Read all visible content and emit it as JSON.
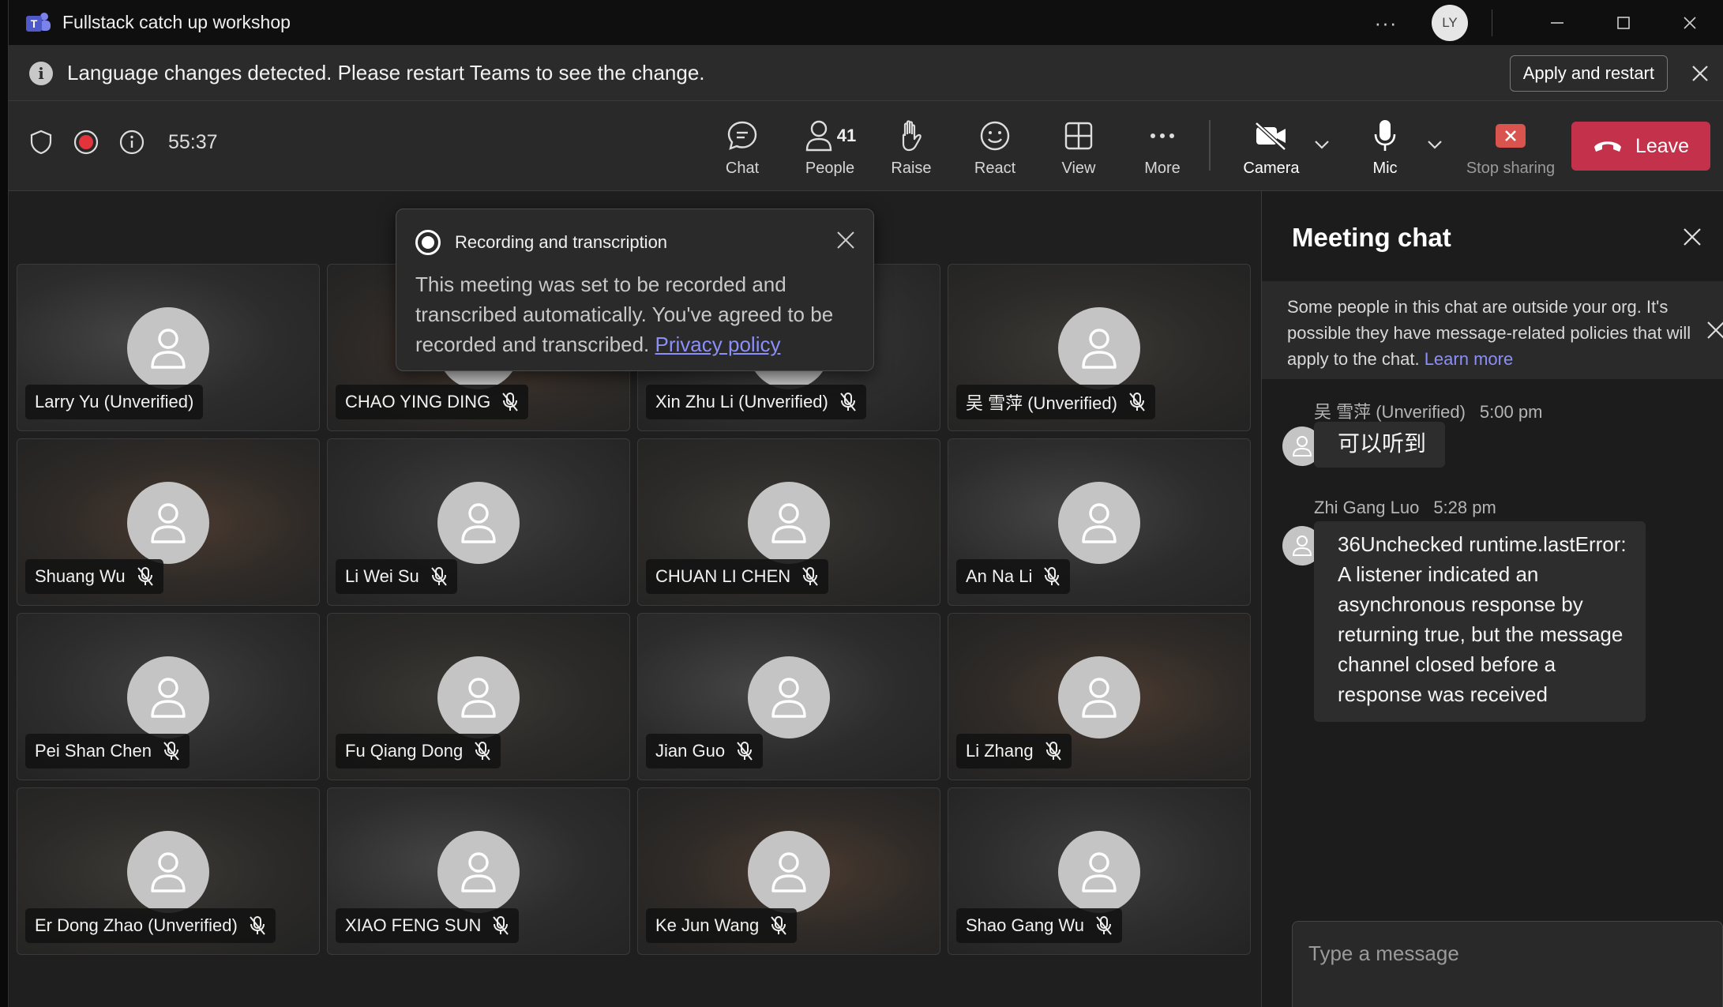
{
  "window": {
    "title": "Fullstack catch up workshop",
    "avatar_initials": "LY"
  },
  "banner": {
    "message": "Language changes detected. Please restart Teams to see the change.",
    "apply_label": "Apply and restart"
  },
  "toolbar": {
    "timer": "55:37",
    "chat": "Chat",
    "people": "People",
    "people_count": "41",
    "raise": "Raise",
    "react": "React",
    "view": "View",
    "more": "More",
    "camera": "Camera",
    "mic": "Mic",
    "stop_sharing": "Stop sharing",
    "leave": "Leave"
  },
  "recording_popup": {
    "title": "Recording and transcription",
    "body": "This meeting was set to be recorded and transcribed automatically. You've agreed to be recorded and transcribed.",
    "link": "Privacy policy"
  },
  "participants": [
    {
      "name": "Larry Yu (Unverified)",
      "muted": false
    },
    {
      "name": "CHAO YING DING",
      "muted": true
    },
    {
      "name": "Xin Zhu Li (Unverified)",
      "muted": true
    },
    {
      "name": "吴 雪萍 (Unverified)",
      "muted": true
    },
    {
      "name": "Shuang Wu",
      "muted": true
    },
    {
      "name": "Li Wei Su",
      "muted": true
    },
    {
      "name": "CHUAN LI CHEN",
      "muted": true
    },
    {
      "name": "An Na Li",
      "muted": true
    },
    {
      "name": "Pei Shan Chen",
      "muted": true
    },
    {
      "name": "Fu Qiang Dong",
      "muted": true
    },
    {
      "name": "Jian Guo",
      "muted": true
    },
    {
      "name": "Li Zhang",
      "muted": true
    },
    {
      "name": "Er Dong Zhao (Unverified)",
      "muted": true
    },
    {
      "name": "XIAO FENG SUN",
      "muted": true
    },
    {
      "name": "Ke Jun Wang",
      "muted": true
    },
    {
      "name": "Shao Gang Wu",
      "muted": true
    }
  ],
  "chat": {
    "title": "Meeting chat",
    "notice": "Some people in this chat are outside your org. It's possible they have message-related policies that will apply to the chat.",
    "notice_link": "Learn more",
    "messages": [
      {
        "author": "吴 雪萍 (Unverified)",
        "time": "5:00 pm",
        "text": "可以听到"
      },
      {
        "author": "Zhi Gang Luo",
        "time": "5:28 pm",
        "text": "36Unchecked runtime.lastError: A listener indicated an asynchronous response by returning true, but the message channel closed before a response was received"
      }
    ],
    "compose_placeholder": "Type a message"
  },
  "colors": {
    "accent": "#7f85f5",
    "leave": "#c4314b",
    "stop_sharing": "#d9534f"
  }
}
